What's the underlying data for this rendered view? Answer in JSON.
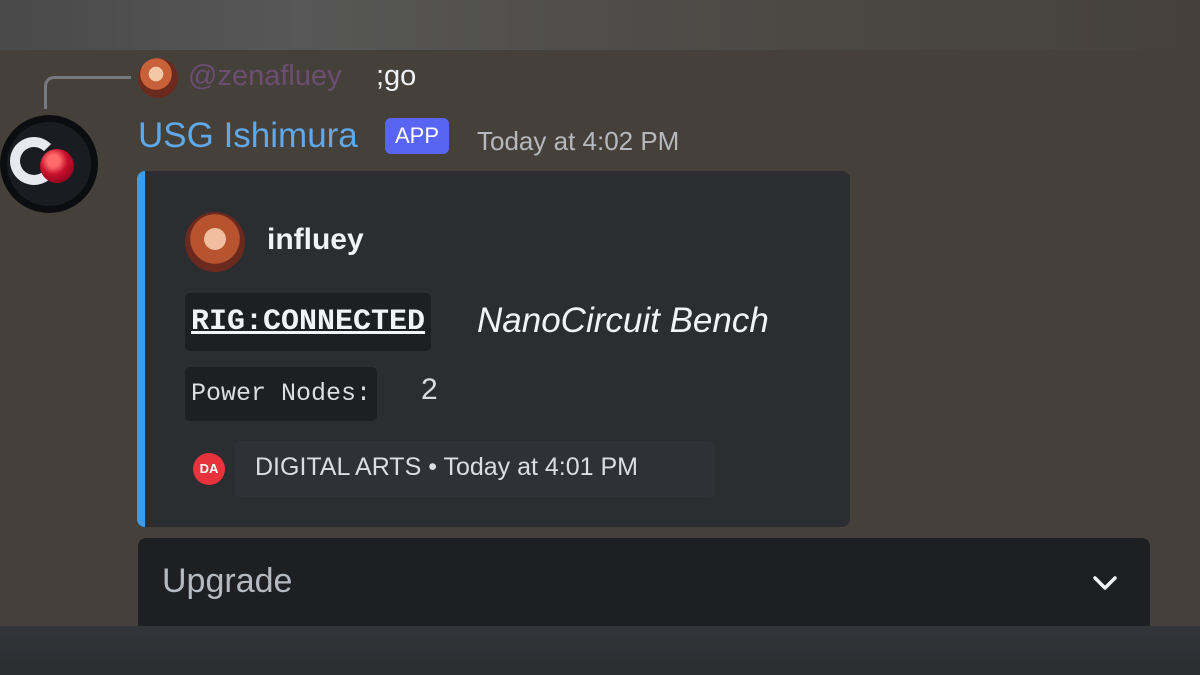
{
  "reply": {
    "mention": "@zenafluey",
    "text": ";go"
  },
  "message": {
    "bot_name": "USG Ishimura",
    "badge": "APP",
    "timestamp": "Today at 4:02 PM"
  },
  "embed": {
    "accent_color": "#3e9ce6",
    "author_name": "influey",
    "title_code": "RIG:CONNECTED",
    "title_italic": "NanoCircuit Bench",
    "field_label": "Power Nodes:",
    "field_value": "2",
    "footer_icon_text": "DA",
    "footer_text": "DIGITAL ARTS • Today at 4:01 PM"
  },
  "select_menu": {
    "placeholder": "Upgrade",
    "icon": "chevron-down-icon"
  }
}
